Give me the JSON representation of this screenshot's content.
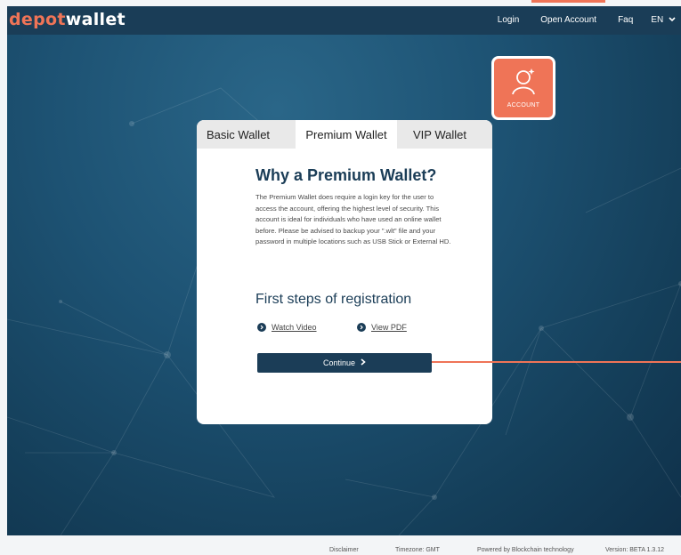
{
  "brand": {
    "part1": "depot",
    "part2": "wallet"
  },
  "nav": {
    "login": "Login",
    "open_account": "Open Account",
    "faq": "Faq",
    "language": "EN"
  },
  "account_badge": {
    "label": "ACCOUNT",
    "icon": "user-icon"
  },
  "tabs": [
    {
      "label": "Basic Wallet"
    },
    {
      "label": "Premium Wallet",
      "active": true
    },
    {
      "label": "VIP Wallet"
    }
  ],
  "card": {
    "title": "Why a Premium Wallet?",
    "description": "The Premium Wallet does require a login key for the user to access the account, offering the highest level of security. This account is ideal for individuals who have used an online wallet before. Please be advised to backup your \".wlt\" file and your password in multiple locations such as USB Stick or External HD.",
    "subtitle": "First steps of registration",
    "link_video": "Watch Video",
    "link_pdf": "View PDF",
    "continue_label": "Continue"
  },
  "footer": {
    "disclaimer": "Disclaimer",
    "timezone": "Timezone: GMT",
    "powered": "Powered by Blockchain technology",
    "version": "Version: BETA 1.3.12"
  },
  "colors": {
    "accent": "#ef7457",
    "navy": "#1b3d57",
    "nav_bg": "#1a3d57"
  }
}
